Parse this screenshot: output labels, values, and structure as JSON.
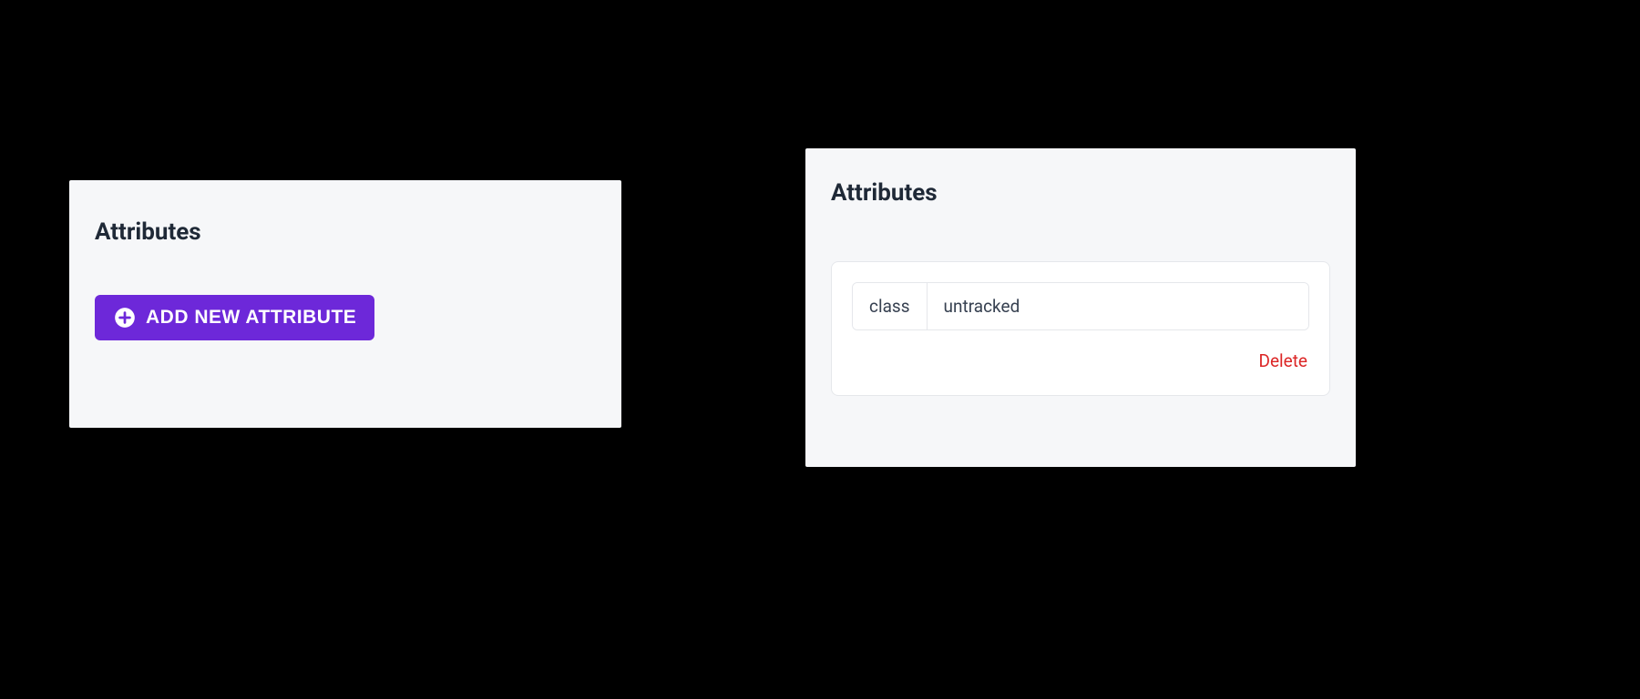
{
  "left_panel": {
    "title": "Attributes",
    "add_button_label": "Add new attribute"
  },
  "right_panel": {
    "title": "Attributes",
    "attribute": {
      "key": "class",
      "value": "untracked"
    },
    "delete_label": "Delete"
  }
}
